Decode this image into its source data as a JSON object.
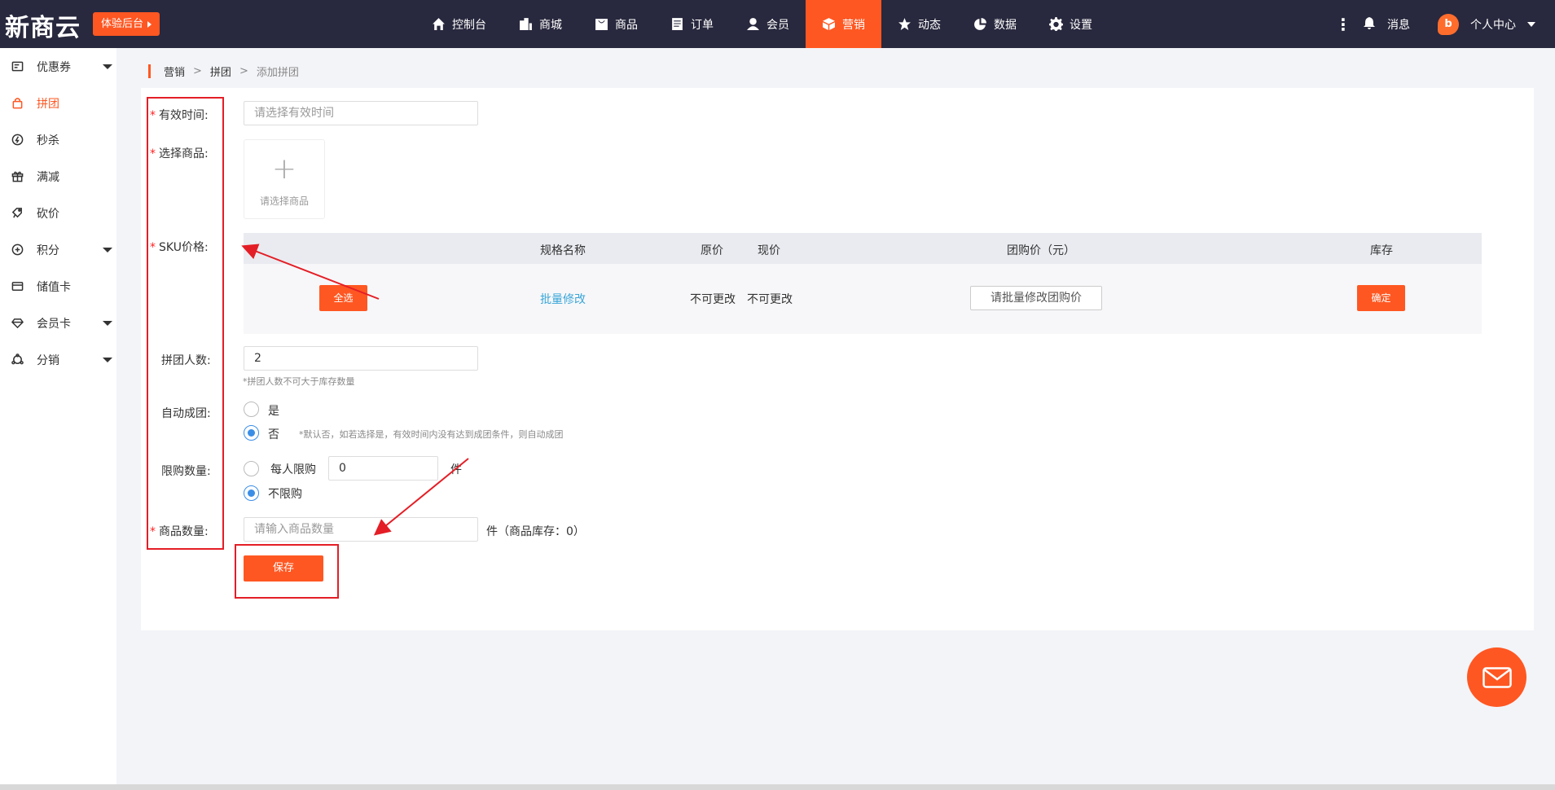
{
  "header": {
    "logo": "新商云",
    "trial_button": "体验后台",
    "nav": [
      {
        "label": "控制台",
        "icon": "home-icon"
      },
      {
        "label": "商城",
        "icon": "building-icon"
      },
      {
        "label": "商品",
        "icon": "bag-icon"
      },
      {
        "label": "订单",
        "icon": "clipboard-icon"
      },
      {
        "label": "会员",
        "icon": "user-icon"
      },
      {
        "label": "营销",
        "icon": "cube-icon",
        "active": true
      },
      {
        "label": "动态",
        "icon": "star-icon"
      },
      {
        "label": "数据",
        "icon": "pie-chart-icon"
      },
      {
        "label": "设置",
        "icon": "gear-icon"
      }
    ],
    "messages": "消息",
    "user_center": "个人中心"
  },
  "sidebar": {
    "items": [
      {
        "label": "优惠券",
        "icon": "coupon-icon",
        "expandable": true
      },
      {
        "label": "拼团",
        "icon": "group-buy-icon",
        "active": true
      },
      {
        "label": "秒杀",
        "icon": "flash-sale-icon"
      },
      {
        "label": "满减",
        "icon": "gift-icon"
      },
      {
        "label": "砍价",
        "icon": "bargain-icon"
      },
      {
        "label": "积分",
        "icon": "points-icon",
        "expandable": true
      },
      {
        "label": "储值卡",
        "icon": "card-icon"
      },
      {
        "label": "会员卡",
        "icon": "diamond-icon",
        "expandable": true
      },
      {
        "label": "分销",
        "icon": "distribution-icon",
        "expandable": true
      }
    ]
  },
  "breadcrumb": {
    "level1": "营销",
    "sep": ">",
    "level2": "拼团",
    "level3": "添加拼团"
  },
  "form": {
    "valid_time": {
      "label": "有效时间:",
      "placeholder": "请选择有效时间"
    },
    "select_product": {
      "label": "选择商品:",
      "picker_text": "请选择商品"
    },
    "sku_price": {
      "label": "SKU价格:",
      "headers": {
        "spec_name": "规格名称",
        "original_price": "原价",
        "current_price": "现价",
        "group_price": "团购价（元）",
        "stock": "库存"
      },
      "select_all": "全选",
      "batch_edit": "批量修改",
      "original_value": "不可更改",
      "current_value": "不可更改",
      "group_price_placeholder": "请批量修改团购价",
      "confirm": "确定"
    },
    "group_size": {
      "label": "拼团人数:",
      "value": "2",
      "hint": "*拼团人数不可大于库存数量"
    },
    "auto_group": {
      "label": "自动成团:",
      "yes": "是",
      "no": "否",
      "selected": "no",
      "hint": "*默认否，如若选择是，有效时间内没有达到成团条件，则自动成团"
    },
    "purchase_limit": {
      "label": "限购数量:",
      "per_person": "每人限购",
      "per_person_value": "0",
      "unit": "件",
      "unlimited": "不限购",
      "selected": "unlimited"
    },
    "product_quantity": {
      "label": "商品数量:",
      "placeholder": "请输入商品数量",
      "suffix": "件（商品库存：0）"
    },
    "save": "保存"
  },
  "colors": {
    "accent": "#ff5722",
    "topbar": "#28283e",
    "annotation": "#e41e26",
    "link": "#3aa6d8"
  }
}
